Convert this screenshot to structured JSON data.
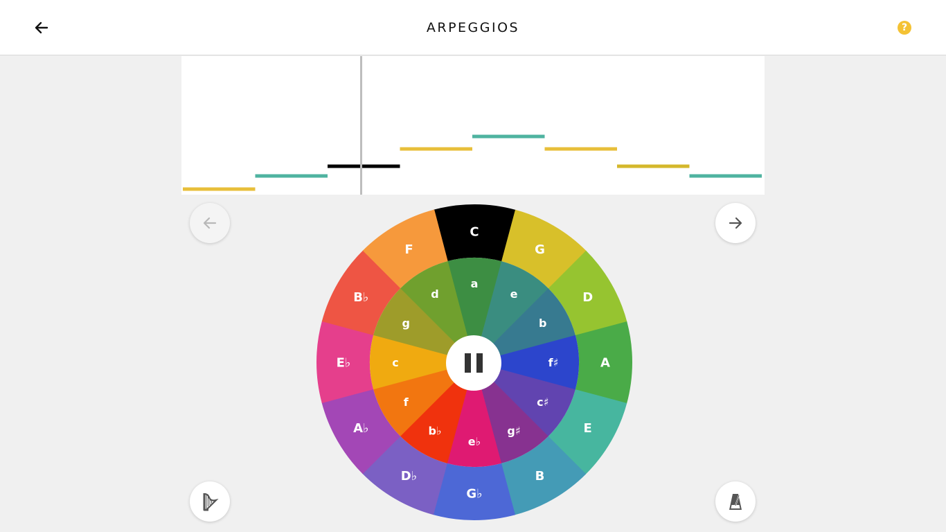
{
  "header": {
    "title": "ARPEGGIOS",
    "help_label": "?"
  },
  "colors": {
    "accent": "#f4c234",
    "note_colors": [
      "#e8bf3a",
      "#4fb3a0",
      "#000000"
    ]
  },
  "roll_notes": [
    {
      "color": "#e8bf3a"
    },
    {
      "color": "#4fb3a0"
    },
    {
      "color": "#000000"
    },
    {
      "color": "#e8bf3a"
    },
    {
      "color": "#4fb3a0"
    },
    {
      "color": "#e8bf3a"
    },
    {
      "color": "#d4b82c"
    },
    {
      "color": "#4fb3a0"
    }
  ],
  "wheel": {
    "outer": [
      {
        "label": "C",
        "color": "#000000"
      },
      {
        "label": "G",
        "color": "#d8c02a"
      },
      {
        "label": "D",
        "color": "#96c430"
      },
      {
        "label": "A",
        "color": "#4aab48"
      },
      {
        "label": "E",
        "color": "#47b69f"
      },
      {
        "label": "B",
        "color": "#449bb6"
      },
      {
        "label": "G♭",
        "color": "#4d68d6"
      },
      {
        "label": "D♭",
        "color": "#7b60c4"
      },
      {
        "label": "A♭",
        "color": "#a347b6"
      },
      {
        "label": "E♭",
        "color": "#e53f8c"
      },
      {
        "label": "B♭",
        "color": "#ee5544"
      },
      {
        "label": "F",
        "color": "#f6993c"
      }
    ],
    "inner": [
      {
        "label": "a",
        "color": "#3d8e43"
      },
      {
        "label": "e",
        "color": "#3a8d80"
      },
      {
        "label": "b",
        "color": "#377a90"
      },
      {
        "label": "f♯",
        "color": "#2c45cc"
      },
      {
        "label": "c♯",
        "color": "#6144b0"
      },
      {
        "label": "g♯",
        "color": "#873290"
      },
      {
        "label": "e♭",
        "color": "#df1a72"
      },
      {
        "label": "b♭",
        "color": "#f0320d"
      },
      {
        "label": "f",
        "color": "#f27610"
      },
      {
        "label": "c",
        "color": "#f0aa10"
      },
      {
        "label": "g",
        "color": "#9e9c2a"
      },
      {
        "label": "d",
        "color": "#70a02e"
      }
    ]
  },
  "controls": {
    "prev_icon": "arrow-left-icon",
    "next_icon": "arrow-right-icon",
    "instrument_icon": "harp-icon",
    "tempo_icon": "metronome-icon",
    "playback_icon": "pause-icon"
  }
}
